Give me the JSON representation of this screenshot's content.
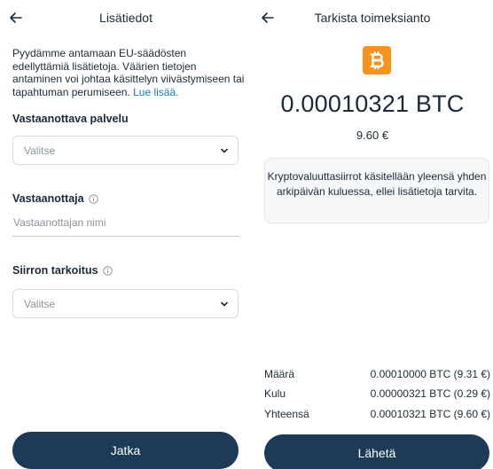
{
  "left": {
    "title": "Lisätiedot",
    "intro_text": "Pyydämme antamaan EU-säädösten edellyttämiä lisätietoja. Väärien tietojen antaminen voi johtaa käsittelyn viivästymiseen tai tapahtuman perumiseen.",
    "intro_link": "Lue lisää.",
    "receiving_service": {
      "label": "Vastaanottava palvelu",
      "placeholder": "Valitse"
    },
    "recipient": {
      "label": "Vastaanottaja",
      "placeholder": "Vastaanottajan nimi"
    },
    "purpose": {
      "label": "Siirron tarkoitus",
      "placeholder": "Valitse"
    },
    "continue_label": "Jatka"
  },
  "right": {
    "title": "Tarkista toimeksianto",
    "amount": "0.00010321 BTC",
    "fiat": "9.60 €",
    "notice": "Kryptovaluuttasiirrot käsitellään yleensä yhden arkipäivän kuluessa, ellei lisätietoja tarvita.",
    "summary": [
      {
        "key": "Määrä",
        "value": "0.00010000 BTC (9.31 €)"
      },
      {
        "key": "Kulu",
        "value": "0.00000321 BTC (0.29 €)"
      },
      {
        "key": "Yhteensä",
        "value": "0.00010321 BTC (9.60 €)"
      }
    ],
    "send_label": "Lähetä"
  },
  "colors": {
    "primary_button": "#1d3a57",
    "link": "#1a78c2",
    "bitcoin": "#f7931a"
  },
  "icons": [
    "back-arrow-icon",
    "info-icon",
    "chevron-down-icon",
    "bitcoin-icon"
  ]
}
